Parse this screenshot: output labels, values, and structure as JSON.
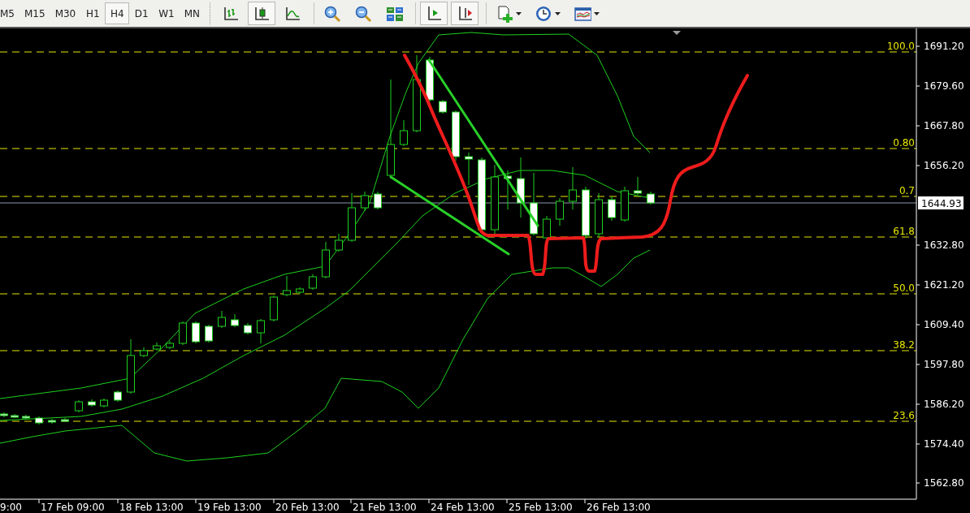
{
  "toolbar": {
    "timeframes": [
      {
        "label": "M5",
        "selected": false
      },
      {
        "label": "M15",
        "selected": false
      },
      {
        "label": "M30",
        "selected": false
      },
      {
        "label": "H1",
        "selected": false
      },
      {
        "label": "H4",
        "selected": true
      },
      {
        "label": "D1",
        "selected": false
      },
      {
        "label": "W1",
        "selected": false
      },
      {
        "label": "MN",
        "selected": false
      }
    ],
    "tools": [
      {
        "kind": "bars",
        "selected": false
      },
      {
        "kind": "candles",
        "selected": true
      },
      {
        "kind": "line",
        "selected": false
      },
      {
        "kind": "zoomin",
        "selected": false
      },
      {
        "kind": "zoomout",
        "selected": false
      },
      {
        "kind": "tile",
        "selected": false
      },
      {
        "kind": "autoscroll",
        "selected": true
      },
      {
        "kind": "shift",
        "selected": true
      },
      {
        "kind": "indicator",
        "selected": false
      },
      {
        "kind": "periods",
        "selected": false
      },
      {
        "kind": "template",
        "selected": false
      }
    ]
  },
  "chart": {
    "fib_levels": [
      {
        "label": "100.0"
      },
      {
        "label": "0.80"
      },
      {
        "label": "0.7"
      },
      {
        "label": "61.8"
      },
      {
        "label": "50.0"
      },
      {
        "label": "38.2"
      },
      {
        "label": "23.6"
      }
    ],
    "price_axis": [
      "1691.20",
      "1679.60",
      "1667.80",
      "1656.20",
      "1632.80",
      "1621.20",
      "1609.40",
      "1597.80",
      "1586.20",
      "1574.40",
      "1562.80"
    ],
    "current_price": "1644.93",
    "time_axis": [
      "9:00",
      "17 Feb 09:00",
      "18 Feb 13:00",
      "19 Feb 13:00",
      "20 Feb 13:00",
      "21 Feb 13:00",
      "24 Feb 13:00",
      "25 Feb 13:00",
      "26 Feb 13:00"
    ]
  }
}
